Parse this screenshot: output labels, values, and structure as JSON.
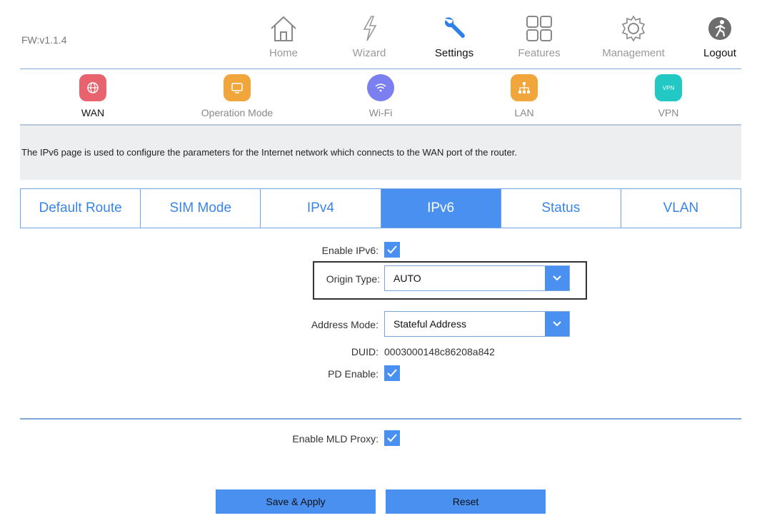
{
  "firmware": "FW:v1.1.4",
  "topnav": {
    "items": [
      {
        "label": "Home",
        "icon": "home-icon"
      },
      {
        "label": "Wizard",
        "icon": "wizard-icon"
      },
      {
        "label": "Settings",
        "icon": "wrench-icon"
      },
      {
        "label": "Features",
        "icon": "grid-icon"
      },
      {
        "label": "Management",
        "icon": "gear-icon"
      },
      {
        "label": "Logout",
        "icon": "logout-icon"
      }
    ],
    "active": "Settings"
  },
  "subnav": {
    "items": [
      {
        "label": "WAN",
        "icon": "globe-icon",
        "color": "#e8636e"
      },
      {
        "label": "Operation Mode",
        "icon": "monitor-icon",
        "color": "#f0a63a"
      },
      {
        "label": "Wi-Fi",
        "icon": "wifi-icon",
        "color": "#7b7ff0"
      },
      {
        "label": "LAN",
        "icon": "network-icon",
        "color": "#f0a63a"
      },
      {
        "label": "VPN",
        "icon": "vpn-icon",
        "color": "#22c9c4",
        "icon_text": "VPN"
      }
    ],
    "active": "WAN"
  },
  "description": "The IPv6 page is used to configure the parameters for the Internet network which connects to the WAN port of the router.",
  "tabs": {
    "items": [
      "Default Route",
      "SIM Mode",
      "IPv4",
      "IPv6",
      "Status",
      "VLAN"
    ],
    "active": "IPv6"
  },
  "form": {
    "enable_ipv6": {
      "label": "Enable IPv6:",
      "checked": true
    },
    "origin_type": {
      "label": "Origin Type:",
      "value": "AUTO"
    },
    "address_mode": {
      "label": "Address Mode:",
      "value": "Stateful Address"
    },
    "duid": {
      "label": "DUID:",
      "value": "0003000148c86208a842"
    },
    "pd_enable": {
      "label": "PD Enable:",
      "checked": true
    },
    "enable_mld_proxy": {
      "label": "Enable MLD Proxy:",
      "checked": true
    }
  },
  "buttons": {
    "save_apply": "Save & Apply",
    "reset": "Reset"
  },
  "colors": {
    "accent": "#4a90f0",
    "tab_text": "#3a84e8",
    "divider": "#7fa8d8"
  }
}
